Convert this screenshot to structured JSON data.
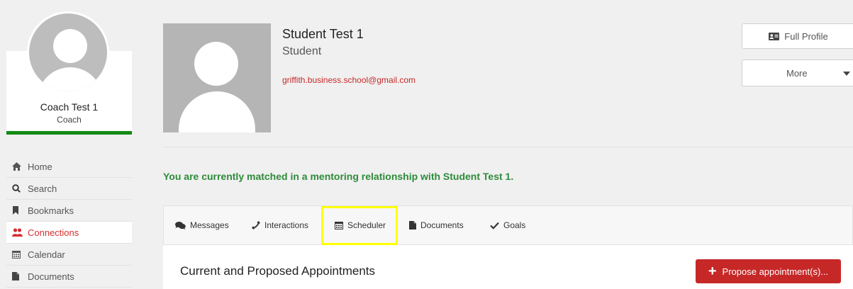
{
  "sidebar": {
    "profile": {
      "name": "Coach Test 1",
      "role": "Coach"
    },
    "nav": [
      {
        "label": "Home",
        "icon": "home-icon"
      },
      {
        "label": "Search",
        "icon": "search-icon"
      },
      {
        "label": "Bookmarks",
        "icon": "bookmark-icon"
      },
      {
        "label": "Connections",
        "icon": "users-icon",
        "active": true
      },
      {
        "label": "Calendar",
        "icon": "calendar-icon"
      },
      {
        "label": "Documents",
        "icon": "document-icon"
      }
    ]
  },
  "student": {
    "name": "Student Test 1",
    "role": "Student",
    "email": "griffith.business.school@gmail.com"
  },
  "actions": {
    "full_profile_label": "Full Profile",
    "more_label": "More"
  },
  "match_message": "You are currently matched in a mentoring relationship with Student Test 1.",
  "tabs": [
    {
      "label": "Messages",
      "icon": "comments-icon"
    },
    {
      "label": "Interactions",
      "icon": "phone-icon"
    },
    {
      "label": "Scheduler",
      "icon": "calendar-icon",
      "highlighted": true
    },
    {
      "label": "Documents",
      "icon": "document-icon"
    },
    {
      "label": "Goals",
      "icon": "check-icon"
    }
  ],
  "content": {
    "section_title": "Current and Proposed Appointments",
    "propose_button_label": "Propose appointment(s)..."
  },
  "colors": {
    "accent_red": "#c62828",
    "success_green": "#2e8b3a",
    "profile_bar_green": "#128a12",
    "highlight_yellow": "#ffff00"
  }
}
